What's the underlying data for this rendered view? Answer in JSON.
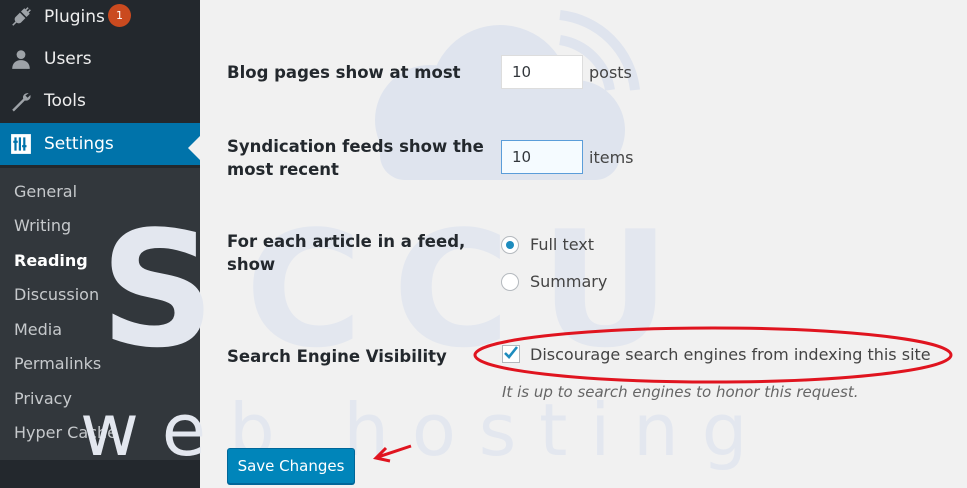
{
  "sidebar": {
    "menu": [
      {
        "label": "Plugins",
        "icon": "plugin-icon",
        "badge": "1"
      },
      {
        "label": "Users",
        "icon": "user-icon"
      },
      {
        "label": "Tools",
        "icon": "wrench-icon"
      },
      {
        "label": "Settings",
        "icon": "settings-sliders-icon",
        "active": true
      }
    ],
    "submenu": [
      {
        "label": "General"
      },
      {
        "label": "Writing"
      },
      {
        "label": "Reading",
        "active": true
      },
      {
        "label": "Discussion"
      },
      {
        "label": "Media"
      },
      {
        "label": "Permalinks"
      },
      {
        "label": "Privacy"
      },
      {
        "label": "Hyper Cache"
      }
    ]
  },
  "form": {
    "blog_pages": {
      "label": "Blog pages show at most",
      "value": "10",
      "unit": "posts"
    },
    "syndication": {
      "label_line1": "Syndication feeds show the",
      "label_line2": "most recent",
      "value": "10",
      "unit": "items"
    },
    "feed_article": {
      "label_line1": "For each article in a feed,",
      "label_line2": "show",
      "options": [
        {
          "label": "Full text",
          "checked": true
        },
        {
          "label": "Summary",
          "checked": false
        }
      ]
    },
    "search_visibility": {
      "label": "Search Engine Visibility",
      "checkbox_label": "Discourage search engines from indexing this site",
      "checked": true,
      "hint": "It is up to search engines to honor this request."
    }
  },
  "save_button": "Save Changes",
  "watermark": {
    "text_top": "SCCU",
    "text_bottom": "w e b   h o s t i n g",
    "color": "#dfe4ee"
  },
  "annotation_color": "#e0141f",
  "colors": {
    "sidebar": "#23282d",
    "submenu": "#32373c",
    "accent": "#0073aa",
    "badge": "#ca4a1f",
    "button": "#0085ba"
  }
}
